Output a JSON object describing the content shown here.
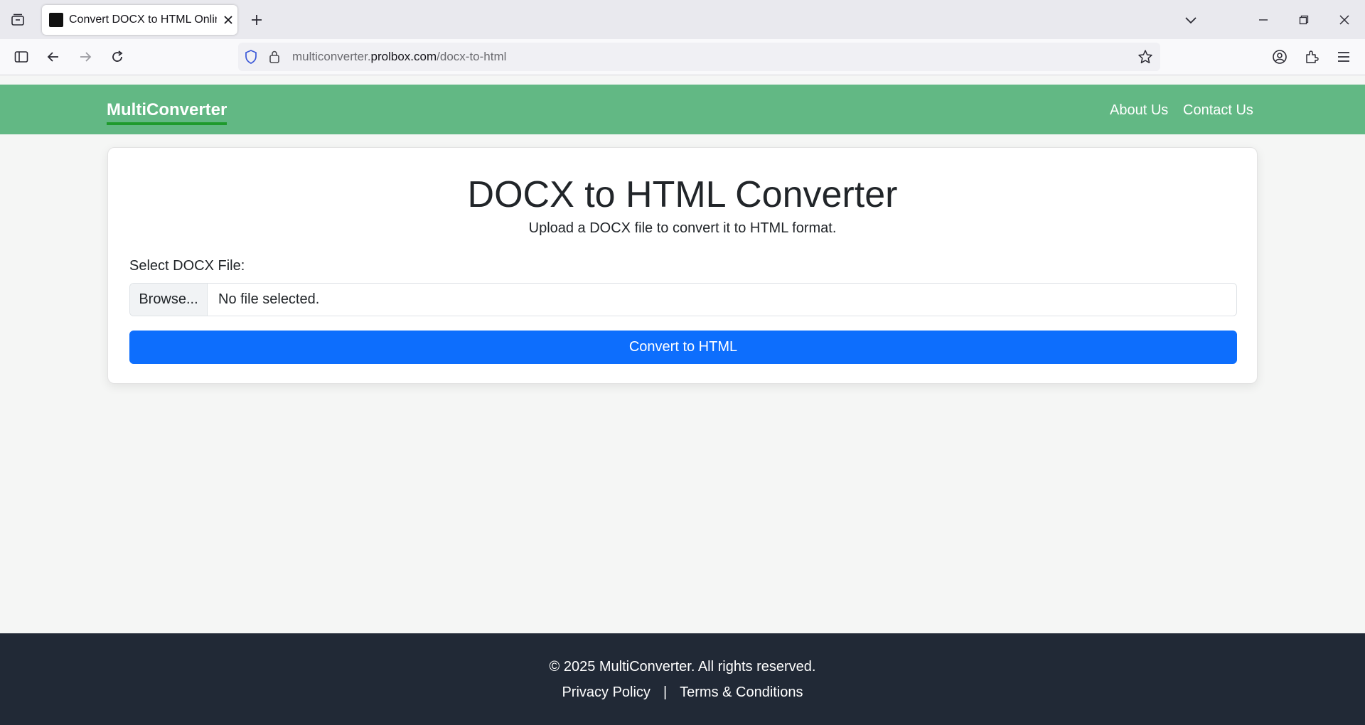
{
  "browser": {
    "tab_title": "Convert DOCX to HTML Online",
    "url_prefix": "multiconverter.",
    "url_host": "prolbox.com",
    "url_path": "/docx-to-html"
  },
  "header": {
    "brand": "MultiConverter",
    "nav": [
      "About Us",
      "Contact Us"
    ]
  },
  "card": {
    "title": "DOCX to HTML Converter",
    "subtitle": "Upload a DOCX file to convert it to HTML format.",
    "field_label": "Select DOCX File:",
    "browse_label": "Browse...",
    "file_status": "No file selected.",
    "convert_label": "Convert to HTML"
  },
  "footer": {
    "copyright": "© 2025 MultiConverter. All rights reserved.",
    "privacy": "Privacy Policy",
    "separator": "|",
    "terms": "Terms & Conditions"
  },
  "colors": {
    "header_bg": "#62b884",
    "brand_underline": "#1e9a2c",
    "button": "#0d6efd",
    "footer_bg": "#212936"
  },
  "icons": [
    "tab-list-icon",
    "close-icon",
    "new-tab-icon",
    "tab-overflow-icon",
    "minimize-icon",
    "restore-icon",
    "window-close-icon",
    "sidebar-icon",
    "back-icon",
    "forward-icon",
    "reload-icon",
    "shield-icon",
    "lock-icon",
    "bookmark-star-icon",
    "account-icon",
    "extensions-icon",
    "menu-icon"
  ]
}
